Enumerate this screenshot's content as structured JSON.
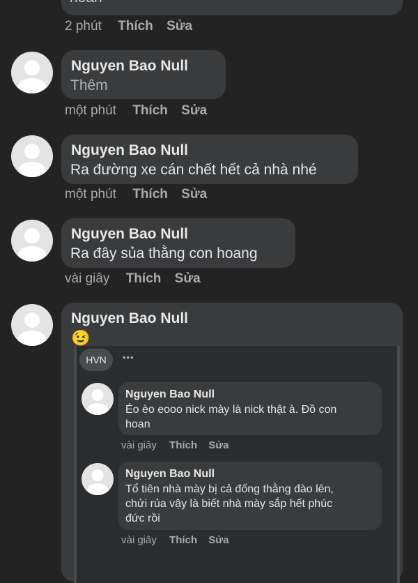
{
  "top_comment": {
    "text_tail": "hoan",
    "time": "2 phút",
    "like": "Thích",
    "edit": "Sửa"
  },
  "comments": [
    {
      "author": "Nguyen Bao Null",
      "text": "Thêm",
      "time": "một phút",
      "like": "Thích",
      "edit": "Sửa"
    },
    {
      "author": "Nguyen Bao Null",
      "text": "Ra đường xe cán chết hết cả nhà nhé",
      "time": "một phút",
      "like": "Thích",
      "edit": "Sửa"
    },
    {
      "author": "Nguyen Bao Null",
      "text": "Ra đây sủa thằng con hoang",
      "time": "vài giây",
      "like": "Thích",
      "edit": "Sửa"
    }
  ],
  "share_comment": {
    "author": "Nguyen Bao Null",
    "emoji": "😉",
    "source_badge": "HVN",
    "more": "•••",
    "replies": [
      {
        "author": "Nguyen Bao Null",
        "lines": [
          "Éo èo eooo nick mày là nick thật à. Đồ con",
          "hoan"
        ],
        "time": "vài giây",
        "like": "Thích",
        "edit": "Sửa"
      },
      {
        "author": "Nguyen Bao Null",
        "lines": [
          "Tổ tiên nhà mày bị cả đống thằng đào lên,",
          "chửi rủa vậy là biết nhà mày sắp hết phúc",
          "đức rồi"
        ],
        "time": "vài giây",
        "like": "Thích",
        "edit": "Sửa"
      }
    ]
  },
  "colors": {
    "background": "#232323",
    "bubble": "#3a3b3c",
    "meta_text": "#a9abb0",
    "avatar": "#e4e4e4"
  }
}
